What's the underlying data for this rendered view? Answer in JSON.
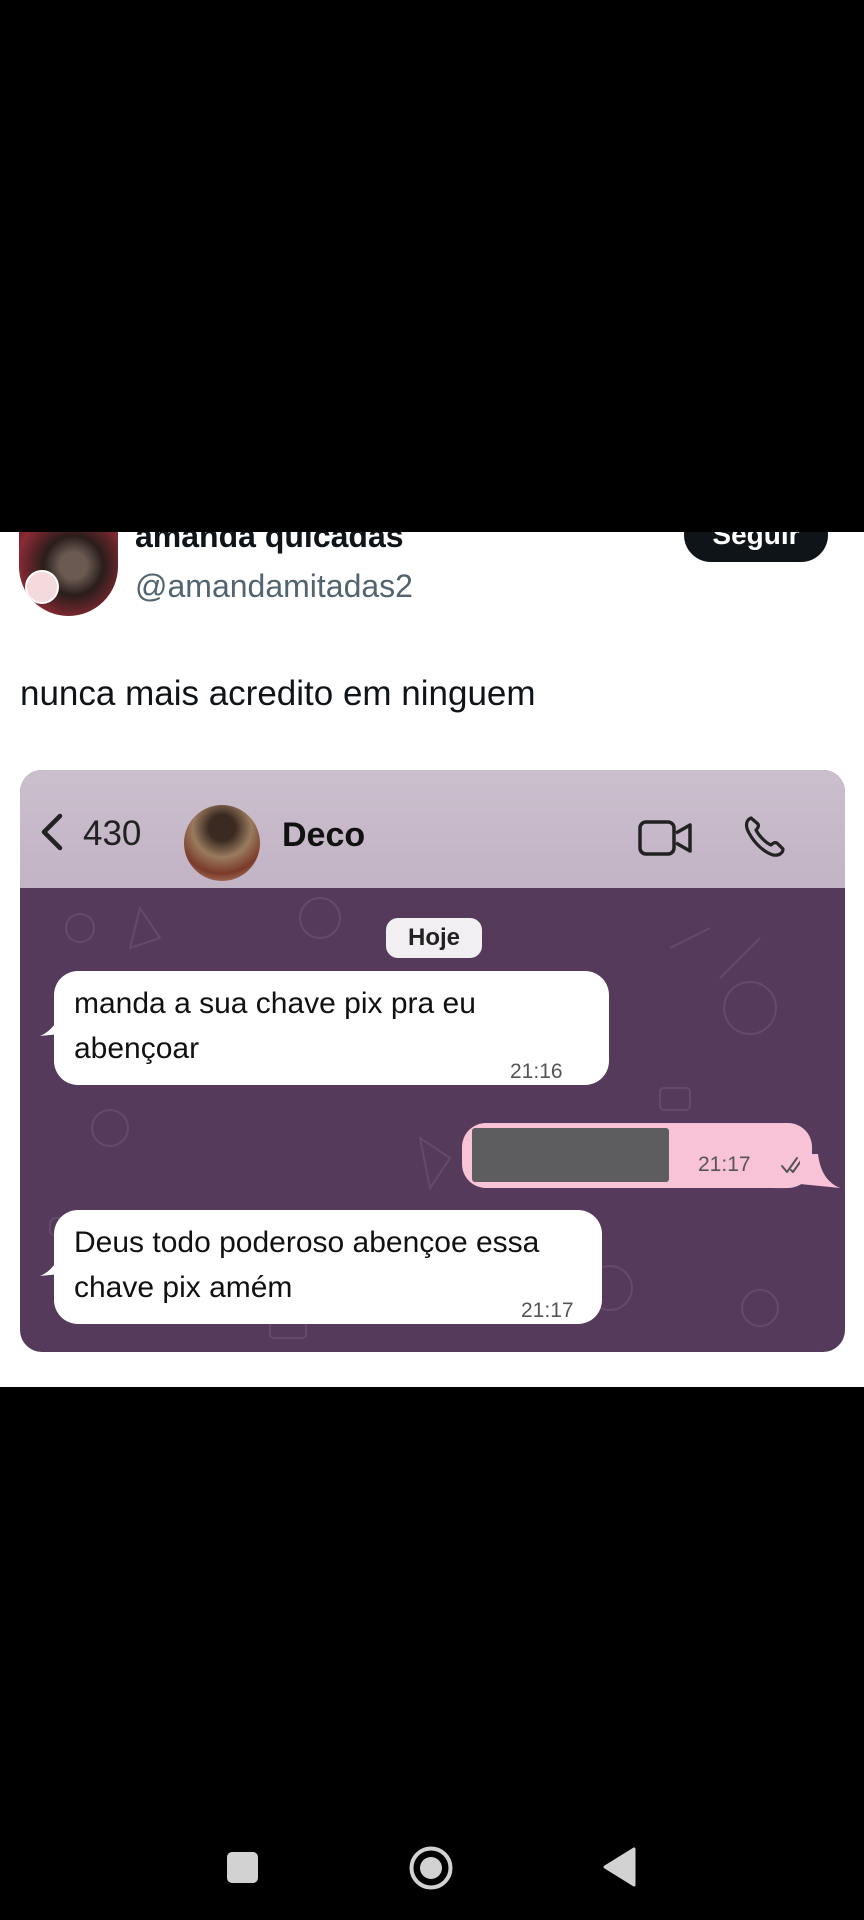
{
  "tweet": {
    "display_name": "amanda quicadas",
    "handle": "@amandamitadas2",
    "follow_label": "Seguir",
    "text": "nunca mais acredito em ninguem"
  },
  "chat": {
    "back_count": "430",
    "contact_name": "Deco",
    "date_label": "Hoje",
    "messages": [
      {
        "direction": "in",
        "line1": "manda a sua chave pix pra eu",
        "line2": "abençoar",
        "time": "21:16"
      },
      {
        "direction": "out",
        "redacted": true,
        "time": "21:17"
      },
      {
        "direction": "in",
        "line1": "Deus todo poderoso abençoe essa",
        "line2": "chave pix amém",
        "time": "21:17"
      }
    ],
    "colors": {
      "header": "#c2b3c5",
      "chat_background": "#553a5c",
      "incoming_bubble": "#ffffff",
      "outgoing_bubble": "#f8c3d6"
    }
  },
  "icons": [
    "chevron-left-icon",
    "video-camera-icon",
    "phone-icon",
    "double-check-icon",
    "square-nav-icon",
    "circle-home-icon",
    "triangle-back-icon"
  ]
}
